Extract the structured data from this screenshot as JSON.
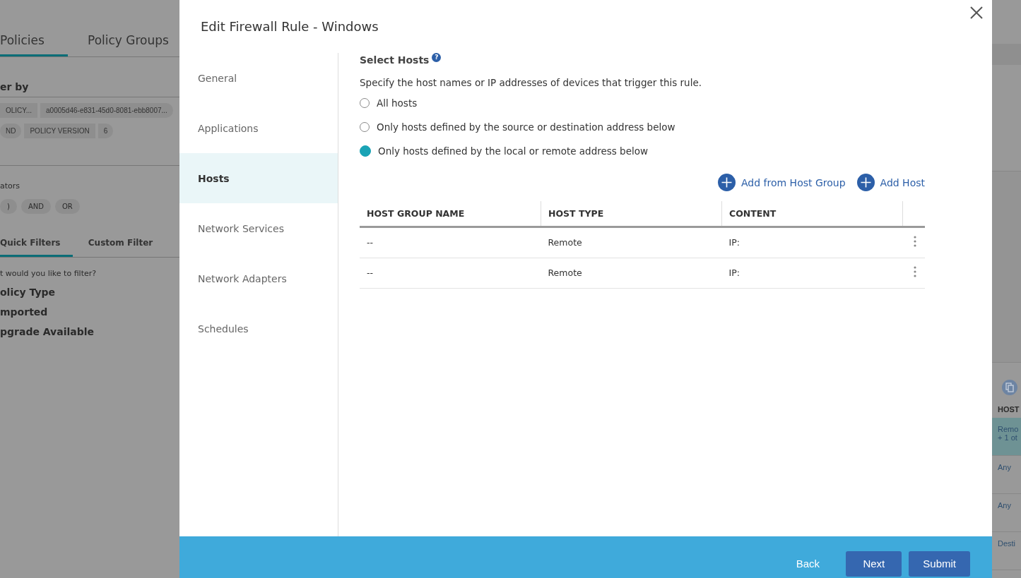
{
  "background": {
    "tabs": [
      {
        "label": "Policies",
        "selected": true
      },
      {
        "label": "Policy Groups",
        "selected": false
      }
    ],
    "filter_title": "er by",
    "filter_chips": [
      [
        {
          "label": "OLICY..."
        },
        {
          "label": "a0005d46-e831-45d0-8081-ebb8007..."
        }
      ],
      [
        {
          "label": "ND"
        },
        {
          "label": "POLICY VERSION"
        },
        {
          "label": "6"
        }
      ]
    ],
    "operators_label": "ators",
    "operators": [
      ")",
      "AND",
      "OR"
    ],
    "filter_tabs": [
      {
        "label": "Quick Filters",
        "selected": true
      },
      {
        "label": "Custom Filter",
        "selected": false
      }
    ],
    "filter_question": "t would you like to filter?",
    "quick_filters": [
      "olicy Type",
      "mported",
      "pgrade Available"
    ],
    "right_column": {
      "column_header": "HOST",
      "rows": [
        {
          "lines": [
            "Remo",
            "+ 1 ot"
          ],
          "selected": true
        },
        {
          "lines": [
            "Any"
          ],
          "selected": false
        },
        {
          "lines": [
            "Any"
          ],
          "selected": false
        },
        {
          "lines": [
            "Desti"
          ],
          "selected": false
        }
      ]
    }
  },
  "dialog": {
    "title": "Edit Firewall Rule - Windows",
    "nav": [
      {
        "label": "General",
        "selected": false
      },
      {
        "label": "Applications",
        "selected": false
      },
      {
        "label": "Hosts",
        "selected": true
      },
      {
        "label": "Network Services",
        "selected": false
      },
      {
        "label": "Network Adapters",
        "selected": false
      },
      {
        "label": "Schedules",
        "selected": false
      }
    ],
    "section_title": "Select Hosts",
    "help_icon": "?",
    "description": "Specify the host names or IP addresses of devices that trigger this rule.",
    "options": [
      {
        "label": "All hosts",
        "selected": false
      },
      {
        "label": "Only hosts defined by the source or destination address below",
        "selected": false
      },
      {
        "label": "Only hosts defined by the local or remote address below",
        "selected": true
      }
    ],
    "actions": [
      "Add from Host Group",
      "Add Host"
    ],
    "table": {
      "columns": [
        "HOST GROUP NAME",
        "HOST TYPE",
        "CONTENT"
      ],
      "rows": [
        {
          "host_group_name": "--",
          "host_type": "Remote",
          "content": "IP:"
        },
        {
          "host_group_name": "--",
          "host_type": "Remote",
          "content": "IP:"
        }
      ]
    },
    "footer_buttons": [
      {
        "label": "Back",
        "kind": "link"
      },
      {
        "label": "Next",
        "kind": "primary"
      },
      {
        "label": "Submit",
        "kind": "primary"
      }
    ]
  }
}
